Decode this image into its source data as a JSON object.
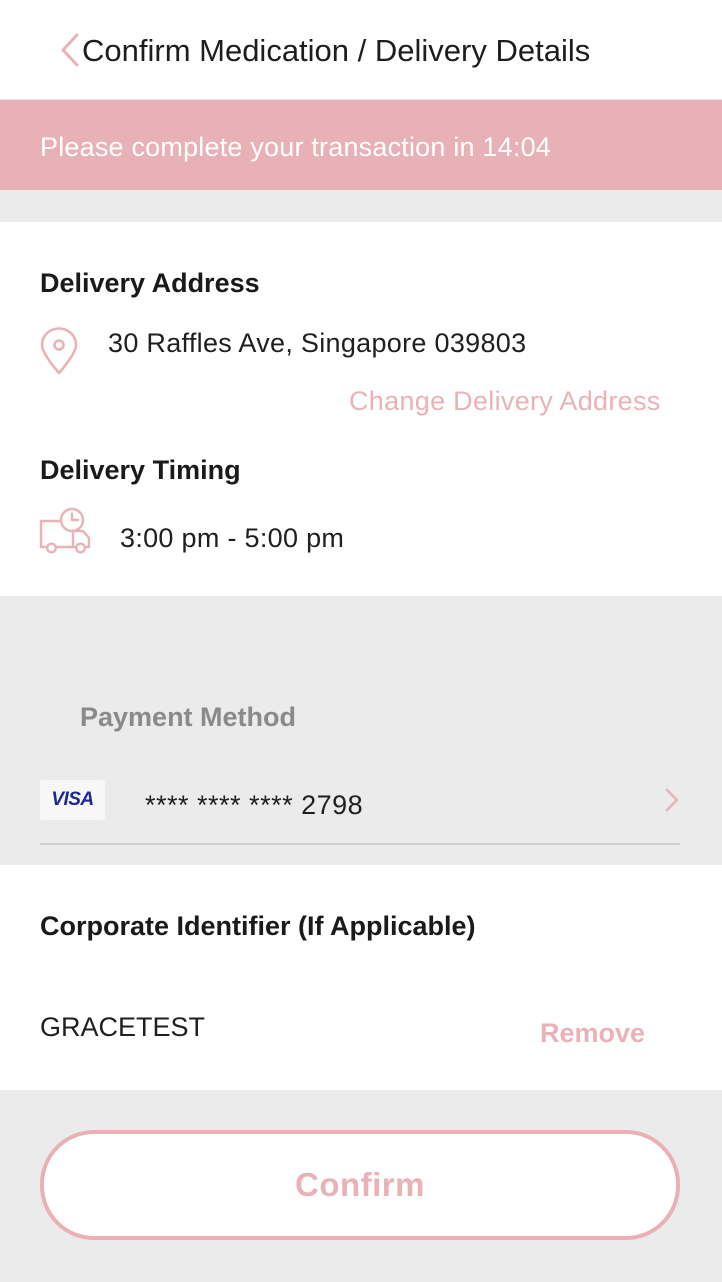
{
  "header": {
    "title": "Confirm Medication / Delivery Details",
    "back_icon": "chevron-left-icon"
  },
  "banner": {
    "text": "Please complete your transaction in 14:04",
    "background_color": "#e8b1b6"
  },
  "delivery": {
    "address_title": "Delivery Address",
    "address_icon": "location-pin-icon",
    "address": "30 Raffles Ave, Singapore 039803",
    "change_address_label": "Change Delivery Address",
    "timing_title": "Delivery Timing",
    "timing_icon": "delivery-truck-clock-icon",
    "timing": "3:00 pm - 5:00 pm"
  },
  "payment": {
    "title": "Payment Method",
    "card_brand": "VISA",
    "card_number": "**** **** **** 2798",
    "chevron_icon": "chevron-right-icon"
  },
  "corporate": {
    "title": "Corporate Identifier (If Applicable)",
    "value": "GRACETEST",
    "remove_label": "Remove"
  },
  "footer": {
    "confirm_label": "Confirm"
  },
  "colors": {
    "accent": "#eab2b6",
    "background": "#ebebeb",
    "card": "#ffffff"
  }
}
